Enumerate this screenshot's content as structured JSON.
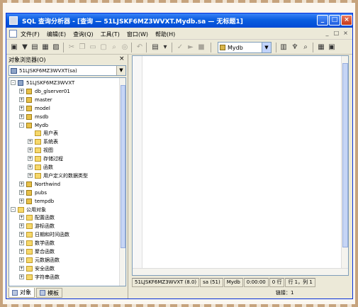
{
  "window": {
    "title": "SQL 查询分析器 - [查询 — 51LJSKF6MZ3WVXT.Mydb.sa — 无标题1]",
    "controls": [
      "_",
      "□",
      "×"
    ]
  },
  "menu": {
    "items": [
      "文件(F)",
      "编辑(E)",
      "查询(Q)",
      "工具(T)",
      "窗口(W)",
      "帮助(H)"
    ],
    "mdi_controls": [
      "_",
      "□",
      "×"
    ]
  },
  "toolbar": {
    "database": "Mydb"
  },
  "object_browser": {
    "title": "对象浏览器(O)",
    "close": "×",
    "server": "51LJSKF6MZ3WVXT(sa)",
    "tabs": [
      "对象",
      "模板"
    ],
    "tree": [
      {
        "label": "51LJSKF6MZ3WVXT",
        "toggle": "-",
        "icon": "server",
        "indent": 0
      },
      {
        "label": "db_glserver01",
        "toggle": "+",
        "icon": "db",
        "indent": 1
      },
      {
        "label": "master",
        "toggle": "+",
        "icon": "db",
        "indent": 1
      },
      {
        "label": "model",
        "toggle": "+",
        "icon": "db",
        "indent": 1
      },
      {
        "label": "msdb",
        "toggle": "+",
        "icon": "db",
        "indent": 1
      },
      {
        "label": "Mydb",
        "toggle": "-",
        "icon": "db",
        "indent": 1
      },
      {
        "label": "用户表",
        "toggle": "",
        "icon": "folder",
        "indent": 2
      },
      {
        "label": "系统表",
        "toggle": "+",
        "icon": "folder",
        "indent": 2
      },
      {
        "label": "视图",
        "toggle": "+",
        "icon": "folder",
        "indent": 2
      },
      {
        "label": "存储过程",
        "toggle": "+",
        "icon": "folder",
        "indent": 2
      },
      {
        "label": "函数",
        "toggle": "+",
        "icon": "folder",
        "indent": 2
      },
      {
        "label": "用户定义的数据类型",
        "toggle": "+",
        "icon": "folder",
        "indent": 2
      },
      {
        "label": "Northwind",
        "toggle": "+",
        "icon": "db",
        "indent": 1
      },
      {
        "label": "pubs",
        "toggle": "+",
        "icon": "db",
        "indent": 1
      },
      {
        "label": "tempdb",
        "toggle": "+",
        "icon": "db",
        "indent": 1
      },
      {
        "label": "公用对象",
        "toggle": "-",
        "icon": "folder",
        "indent": 0
      },
      {
        "label": "配置函数",
        "toggle": "+",
        "icon": "folder",
        "indent": 1
      },
      {
        "label": "游标函数",
        "toggle": "+",
        "icon": "folder",
        "indent": 1
      },
      {
        "label": "日期和时间函数",
        "toggle": "+",
        "icon": "folder",
        "indent": 1
      },
      {
        "label": "数学函数",
        "toggle": "+",
        "icon": "folder",
        "indent": 1
      },
      {
        "label": "聚合函数",
        "toggle": "+",
        "icon": "folder",
        "indent": 1
      },
      {
        "label": "元数据函数",
        "toggle": "+",
        "icon": "folder",
        "indent": 1
      },
      {
        "label": "安全函数",
        "toggle": "+",
        "icon": "folder",
        "indent": 1
      },
      {
        "label": "字符串函数",
        "toggle": "+",
        "icon": "folder",
        "indent": 1
      }
    ]
  },
  "status": {
    "server": "51LJSKF6MZ3WVXT (8.0)",
    "user": "sa (51)",
    "database": "Mydb",
    "time": "0:00:00",
    "rows": "0 行",
    "position": "行 1，列 1",
    "editor_position": "链接：1"
  }
}
